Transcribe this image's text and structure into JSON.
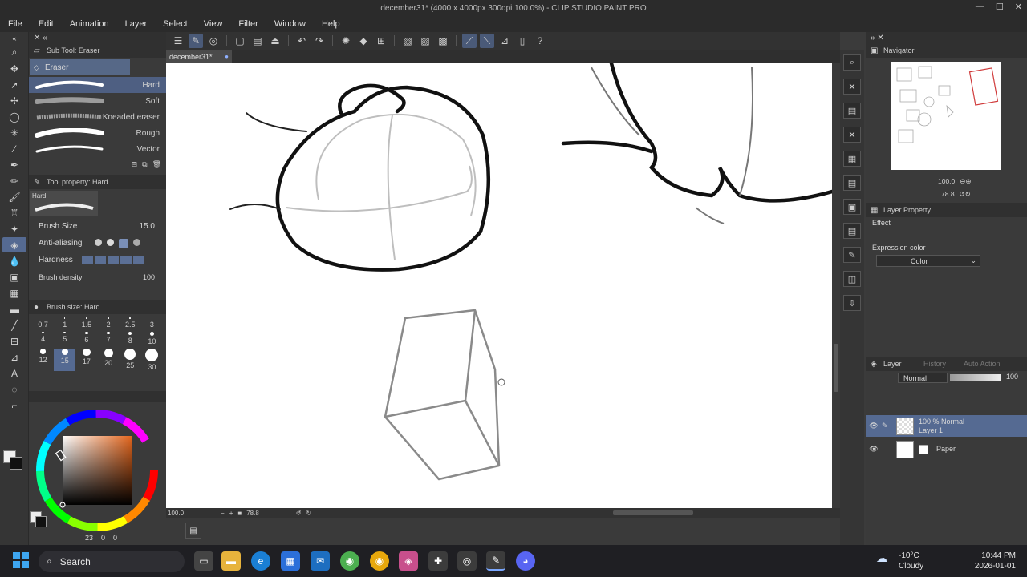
{
  "window": {
    "title": "december31* (4000 x 4000px 300dpi 100.0%)  - CLIP STUDIO PAINT PRO"
  },
  "menu": [
    "File",
    "Edit",
    "Animation",
    "Layer",
    "Select",
    "View",
    "Filter",
    "Window",
    "Help"
  ],
  "document_tab": "december31*",
  "subtool_panel": {
    "title": "Sub Tool: Eraser",
    "group": "Eraser",
    "items": [
      "Hard",
      "Soft",
      "Kneaded eraser",
      "Rough",
      "Vector"
    ]
  },
  "tool_property": {
    "title": "Tool property: Hard",
    "preset": "Hard",
    "brush_size_label": "Brush Size",
    "brush_size_value": "15.0",
    "anti_aliasing_label": "Anti-aliasing",
    "hardness_label": "Hardness",
    "brush_density_label": "Brush density",
    "brush_density_value": "100"
  },
  "brush_size_panel": {
    "title": "Brush size: Hard",
    "sizes": [
      "0.7",
      "1",
      "1.5",
      "2",
      "2.5",
      "3",
      "4",
      "5",
      "6",
      "7",
      "8",
      "10",
      "12",
      "15",
      "17",
      "20",
      "25",
      "30"
    ],
    "selected": "15"
  },
  "color_panel": {
    "readout": "23",
    "readout2": "0",
    "readout3": "0"
  },
  "status": {
    "zoom": "100.0",
    "rotation": "78.8"
  },
  "navigator": {
    "title": "Navigator",
    "zoom_value": "100.0",
    "rotate_value": "78.8"
  },
  "layer_property": {
    "title": "Layer Property",
    "effect_label": "Effect",
    "expression_color_label": "Expression color",
    "expression_color_value": "Color"
  },
  "layer_panel": {
    "tabs": [
      "Layer",
      "History",
      "Auto Action"
    ],
    "blend_mode": "Normal",
    "opacity": "100",
    "layers": [
      {
        "line1": "100 % Normal",
        "line2": "Layer 1"
      },
      {
        "line1": "",
        "line2": "Paper"
      }
    ]
  },
  "taskbar": {
    "search_placeholder": "Search",
    "weather_temp": "-10°C",
    "weather_desc": "Cloudy",
    "time": "10:44 PM",
    "date": "2026-01-01"
  }
}
